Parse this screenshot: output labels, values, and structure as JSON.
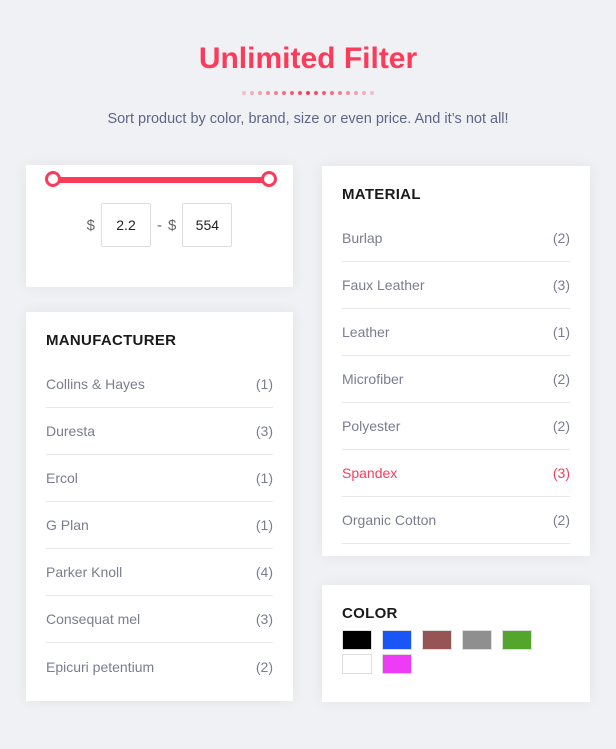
{
  "header": {
    "title": "Unlimited Filter",
    "subtitle": "Sort product by color, brand, size or even price. And it’s not all!"
  },
  "accent": "#fb3b5a",
  "price": {
    "currency": "$",
    "min": "2.2",
    "separator": "-",
    "max": "554"
  },
  "manufacturer": {
    "title": "MANUFACTURER",
    "items": [
      {
        "label": "Collins & Hayes",
        "count": "(1)"
      },
      {
        "label": "Duresta",
        "count": "(3)"
      },
      {
        "label": "Ercol",
        "count": "(1)"
      },
      {
        "label": "G Plan",
        "count": "(1)"
      },
      {
        "label": "Parker Knoll",
        "count": "(4)"
      },
      {
        "label": "Consequat mel",
        "count": "(3)"
      },
      {
        "label": "Epicuri petentium",
        "count": "(2)"
      }
    ]
  },
  "material": {
    "title": "MATERIAL",
    "items": [
      {
        "label": "Burlap",
        "count": "(2)"
      },
      {
        "label": "Faux Leather",
        "count": "(3)"
      },
      {
        "label": "Leather",
        "count": "(1)"
      },
      {
        "label": "Microfiber",
        "count": "(2)"
      },
      {
        "label": "Polyester",
        "count": "(2)"
      },
      {
        "label": "Spandex",
        "count": "(3)",
        "active": true
      },
      {
        "label": "Organic Cotton",
        "count": "(2)"
      }
    ]
  },
  "color": {
    "title": "COLOR",
    "swatches": [
      "#000000",
      "#1a56f5",
      "#975454",
      "#8f8f8f",
      "#53a62b",
      "#ffffff",
      "#ee3bf5"
    ]
  }
}
